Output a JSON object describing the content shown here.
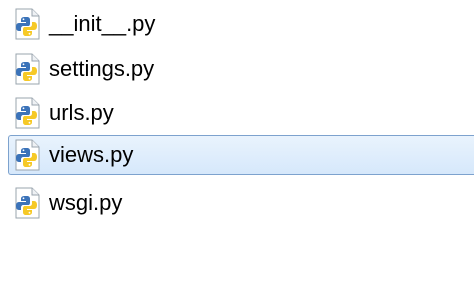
{
  "files": [
    {
      "name": "__init__.py",
      "icon": "python-file-icon",
      "selected": false
    },
    {
      "name": "settings.py",
      "icon": "python-file-icon",
      "selected": false
    },
    {
      "name": "urls.py",
      "icon": "python-file-icon",
      "selected": false
    },
    {
      "name": "views.py",
      "icon": "python-file-icon",
      "selected": true
    },
    {
      "name": "wsgi.py",
      "icon": "python-file-icon",
      "selected": false
    }
  ],
  "colors": {
    "selection_background": "#dceafc",
    "selection_border": "#7da2ce",
    "python_blue": "#3b73b9",
    "python_yellow": "#f6c927",
    "text": "#000000"
  }
}
